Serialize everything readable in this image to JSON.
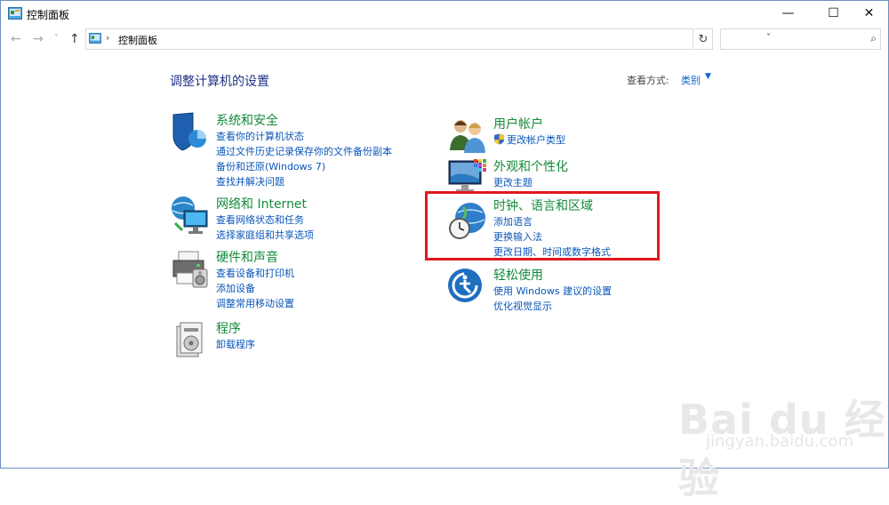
{
  "window": {
    "title": "控制面板",
    "minimize": "—",
    "maximize": "☐",
    "close": "✕"
  },
  "address": {
    "back": "←",
    "forward": "→",
    "recent": "˅",
    "up": "↑",
    "separator": "›",
    "path": "控制面板",
    "dropdown": "˅",
    "refresh": "↻",
    "search_placeholder": "",
    "search_icon": "⌕"
  },
  "content": {
    "title": "调整计算机的设置",
    "view_by_label": "查看方式:",
    "view_by_value": "类别",
    "view_by_caret": "▼"
  },
  "left": [
    {
      "title": "系统和安全",
      "icon": "shield-icon",
      "links": [
        "查看你的计算机状态",
        "通过文件历史记录保存你的文件备份副本",
        "备份和还原(Windows 7)",
        "查找并解决问题"
      ]
    },
    {
      "title": "网络和 Internet",
      "icon": "network-icon",
      "links": [
        "查看网络状态和任务",
        "选择家庭组和共享选项"
      ]
    },
    {
      "title": "硬件和声音",
      "icon": "printer-icon",
      "links": [
        "查看设备和打印机",
        "添加设备",
        "调整常用移动设置"
      ]
    },
    {
      "title": "程序",
      "icon": "programs-icon",
      "links": [
        "卸载程序"
      ]
    }
  ],
  "right": [
    {
      "title": "用户帐户",
      "icon": "users-icon",
      "links": [
        "更改帐户类型"
      ]
    },
    {
      "title": "外观和个性化",
      "icon": "appearance-icon",
      "links": [
        "更改主题"
      ]
    },
    {
      "title": "时钟、语言和区域",
      "icon": "clock-globe-icon",
      "links": [
        "添加语言",
        "更换输入法",
        "更改日期、时间或数字格式"
      ]
    },
    {
      "title": "轻松使用",
      "icon": "ease-of-access-icon",
      "links": [
        "使用 Windows 建议的设置",
        "优化视觉显示"
      ]
    }
  ],
  "watermark": {
    "main": "Bai du 经验",
    "sub": "jingyan.baidu.com"
  }
}
